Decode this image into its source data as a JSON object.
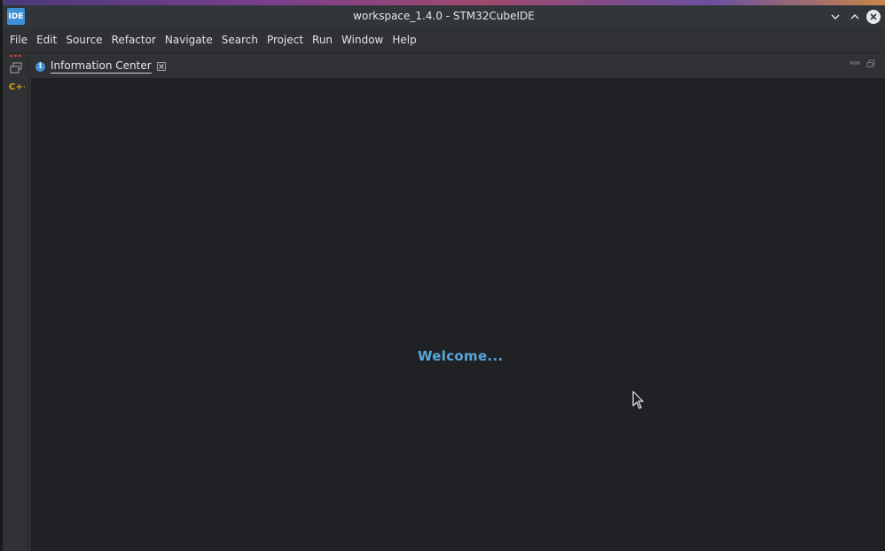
{
  "window": {
    "title": "workspace_1.4.0 - STM32CubeIDE",
    "app_icon_text": "IDE"
  },
  "menu": {
    "items": [
      "File",
      "Edit",
      "Source",
      "Refactor",
      "Navigate",
      "Search",
      "Project",
      "Run",
      "Window",
      "Help"
    ]
  },
  "side_toolbar": {
    "icons": [
      "restore-icon",
      "cpp-perspective-icon"
    ]
  },
  "editor": {
    "tab_label": "Information Center",
    "tab_icon": "info-icon"
  },
  "content": {
    "welcome_text": "Welcome..."
  },
  "colors": {
    "accent": "#5aa7dc",
    "editor_bg": "#1f2124",
    "chrome_bg": "#2f3134",
    "cpp_icon": "#d9a520"
  }
}
